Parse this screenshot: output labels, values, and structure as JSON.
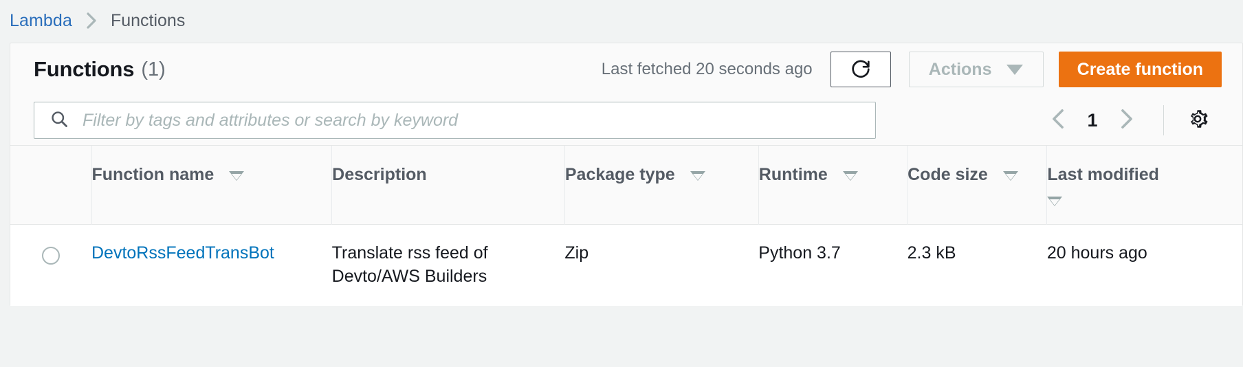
{
  "breadcrumb": {
    "root": "Lambda",
    "separator": "›",
    "current": "Functions"
  },
  "header": {
    "title": "Functions",
    "count": "(1)",
    "last_fetched": "Last fetched 20 seconds ago",
    "refresh_icon": "refresh-icon",
    "actions_label": "Actions",
    "create_label": "Create function",
    "accent_color": "#ec7211",
    "link_color": "#0073bb"
  },
  "search": {
    "icon": "search-icon",
    "value": "",
    "placeholder": "Filter by tags and attributes or search by keyword"
  },
  "pagination": {
    "prev_icon": "chevron-left-icon",
    "page": "1",
    "next_icon": "chevron-right-icon",
    "settings_icon": "gear-icon"
  },
  "table": {
    "columns": [
      {
        "label": "Function name",
        "sortable": true
      },
      {
        "label": "Description",
        "sortable": false
      },
      {
        "label": "Package type",
        "sortable": true
      },
      {
        "label": "Runtime",
        "sortable": true
      },
      {
        "label": "Code size",
        "sortable": true
      },
      {
        "label": "Last modified",
        "sortable": true
      }
    ],
    "rows": [
      {
        "selected": false,
        "name": "DevtoRssFeedTransBot",
        "description": "Translate rss feed of Devto/AWS Builders",
        "package_type": "Zip",
        "runtime": "Python 3.7",
        "code_size": "2.3 kB",
        "last_modified": "20 hours ago"
      }
    ]
  }
}
